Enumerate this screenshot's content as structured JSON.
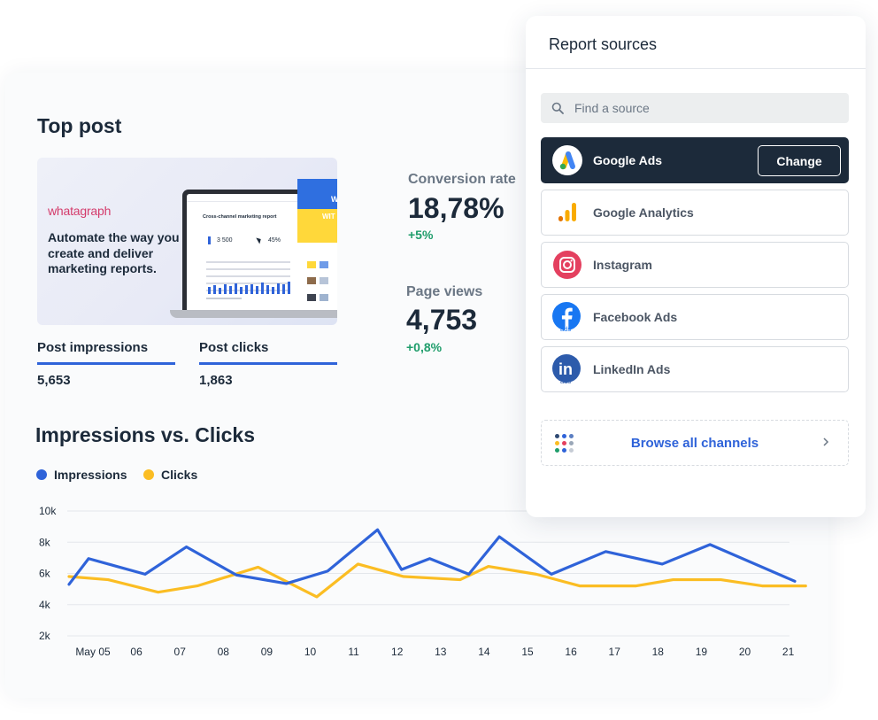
{
  "top_post": {
    "title": "Top post",
    "thumbnail": {
      "brand": "whatagraph",
      "headline": "Automate the way you create and deliver marketing  reports.",
      "screen_title": "Cross-channel marketing report",
      "screen_stat_1": "3 500",
      "screen_stat_2": "45%",
      "panel_text_1": "W",
      "panel_text_2": "WIT"
    },
    "metrics": [
      {
        "label": "Post impressions",
        "value": "5,653"
      },
      {
        "label": "Post clicks",
        "value": "1,863"
      }
    ]
  },
  "kpis": [
    {
      "label": "Conversion rate",
      "value": "18,78%",
      "delta": "+5%"
    },
    {
      "label": "Page views",
      "value": "4,753",
      "delta": "+0,8%"
    }
  ],
  "chart_section": {
    "title": "Impressions vs. Clicks",
    "legend": [
      {
        "name": "Impressions",
        "color": "#2f63d9"
      },
      {
        "name": "Clicks",
        "color": "#fbbd23"
      }
    ]
  },
  "chart_data": {
    "type": "line",
    "title": "Impressions vs. Clicks",
    "x": [
      "May 05",
      "06",
      "07",
      "08",
      "09",
      "10",
      "11",
      "12",
      "13",
      "14",
      "15",
      "16",
      "17",
      "18",
      "19",
      "20",
      "21"
    ],
    "y_ticks": [
      "2k",
      "4k",
      "6k",
      "8k",
      "10k"
    ],
    "ylim": [
      2000,
      10000
    ],
    "grid": true,
    "legend_position": "top-left",
    "series": [
      {
        "name": "Impressions",
        "color": "#2f63d9",
        "points": [
          [
            0.0,
            5300
          ],
          [
            0.45,
            6950
          ],
          [
            1.75,
            5950
          ],
          [
            2.7,
            7700
          ],
          [
            3.85,
            5900
          ],
          [
            5.0,
            5350
          ],
          [
            5.95,
            6150
          ],
          [
            7.1,
            8800
          ],
          [
            7.65,
            6250
          ],
          [
            8.3,
            6950
          ],
          [
            9.2,
            5950
          ],
          [
            9.9,
            8350
          ],
          [
            11.1,
            5950
          ],
          [
            12.35,
            7400
          ],
          [
            13.65,
            6600
          ],
          [
            14.75,
            7850
          ],
          [
            16.7,
            5500
          ]
        ]
      },
      {
        "name": "Clicks",
        "color": "#fbbd23",
        "points": [
          [
            0.0,
            5800
          ],
          [
            0.9,
            5600
          ],
          [
            2.05,
            4800
          ],
          [
            2.95,
            5200
          ],
          [
            4.35,
            6400
          ],
          [
            5.7,
            4500
          ],
          [
            6.65,
            6600
          ],
          [
            7.7,
            5800
          ],
          [
            9.0,
            5600
          ],
          [
            9.65,
            6450
          ],
          [
            10.75,
            5950
          ],
          [
            11.75,
            5200
          ],
          [
            13.05,
            5200
          ],
          [
            13.9,
            5600
          ],
          [
            15.0,
            5600
          ],
          [
            15.95,
            5200
          ],
          [
            16.95,
            5200
          ]
        ]
      }
    ]
  },
  "report_sources": {
    "title": "Report sources",
    "search_placeholder": "Find a source",
    "sources": [
      {
        "name": "Google Ads",
        "icon": "google-ads-icon",
        "selected": true
      },
      {
        "name": "Google Analytics",
        "icon": "google-analytics-icon",
        "selected": false
      },
      {
        "name": "Instagram",
        "icon": "instagram-icon",
        "selected": false
      },
      {
        "name": "Facebook Ads",
        "icon": "facebook-ads-icon",
        "selected": false
      },
      {
        "name": "LinkedIn Ads",
        "icon": "linkedin-ads-icon",
        "selected": false
      }
    ],
    "change_label": "Change",
    "browse_label": "Browse all channels",
    "facebook_sub": "ads",
    "linkedin_sub": "ads",
    "linkedin_mark": "in",
    "colors": {
      "panel_dark": "#1c2a3a",
      "accent_blue": "#2f63d9",
      "delta_green": "#1f9d6b"
    }
  }
}
